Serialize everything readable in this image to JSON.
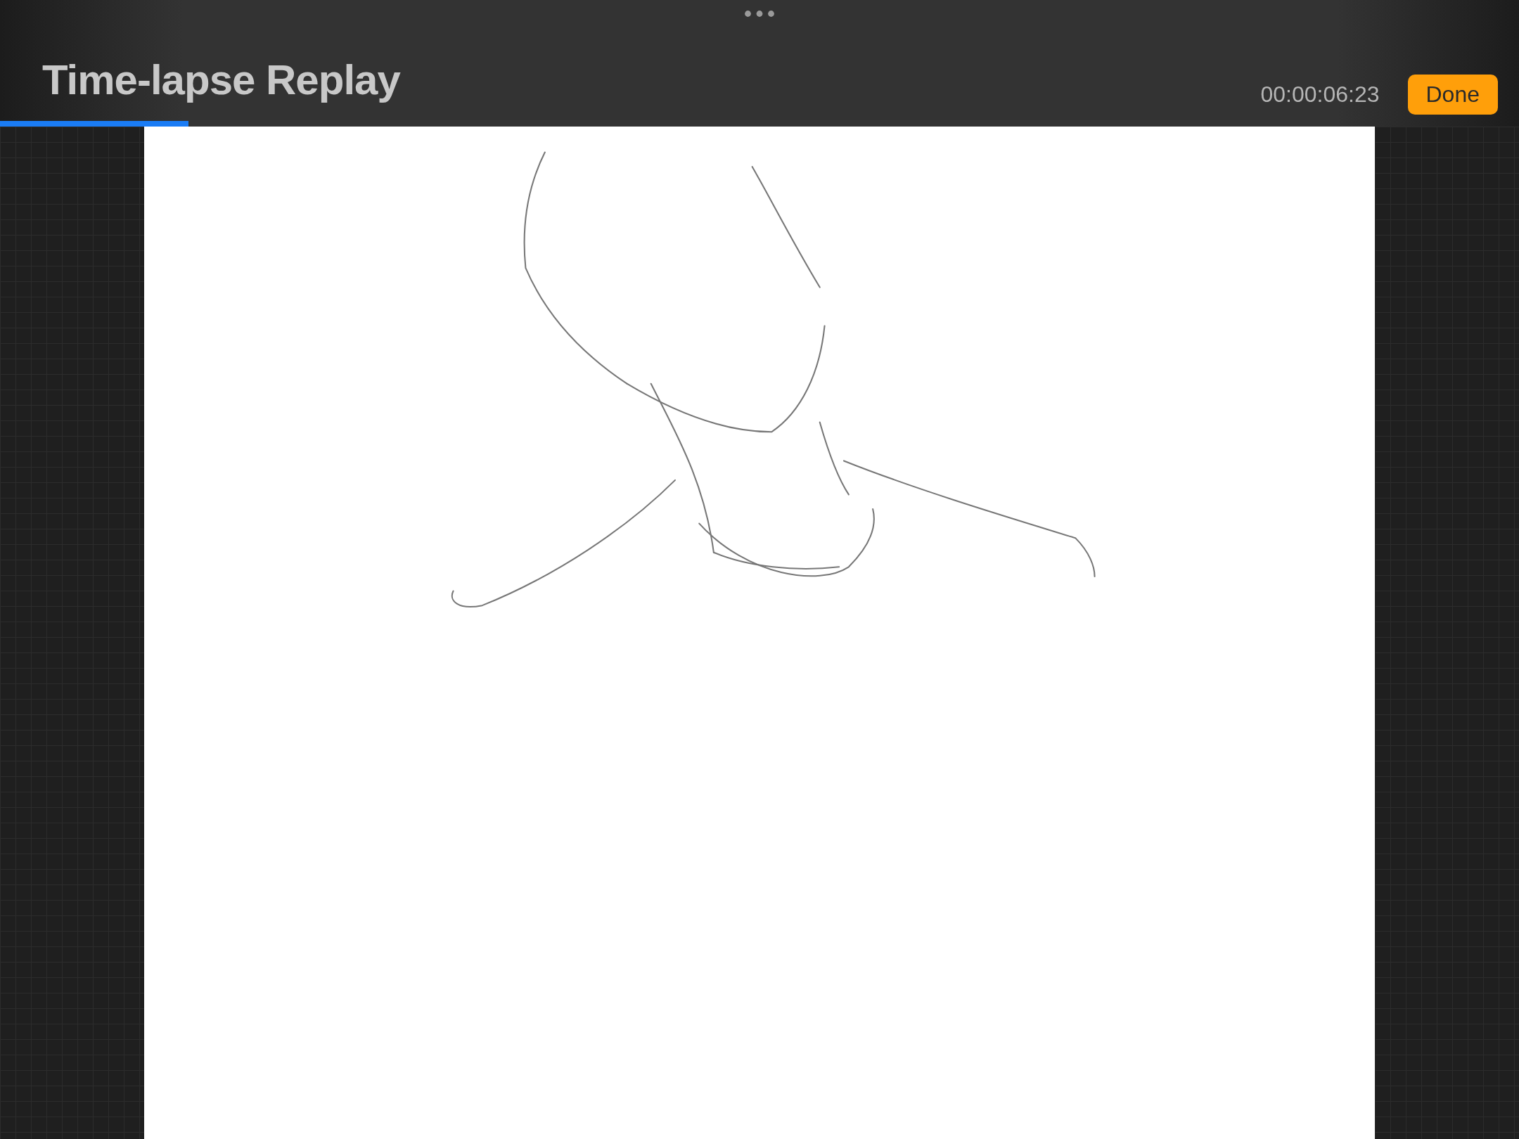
{
  "header": {
    "title": "Time-lapse Replay",
    "elapsed": "00:00:06:23",
    "done_button": "Done"
  },
  "playback": {
    "level": 0.124
  }
}
